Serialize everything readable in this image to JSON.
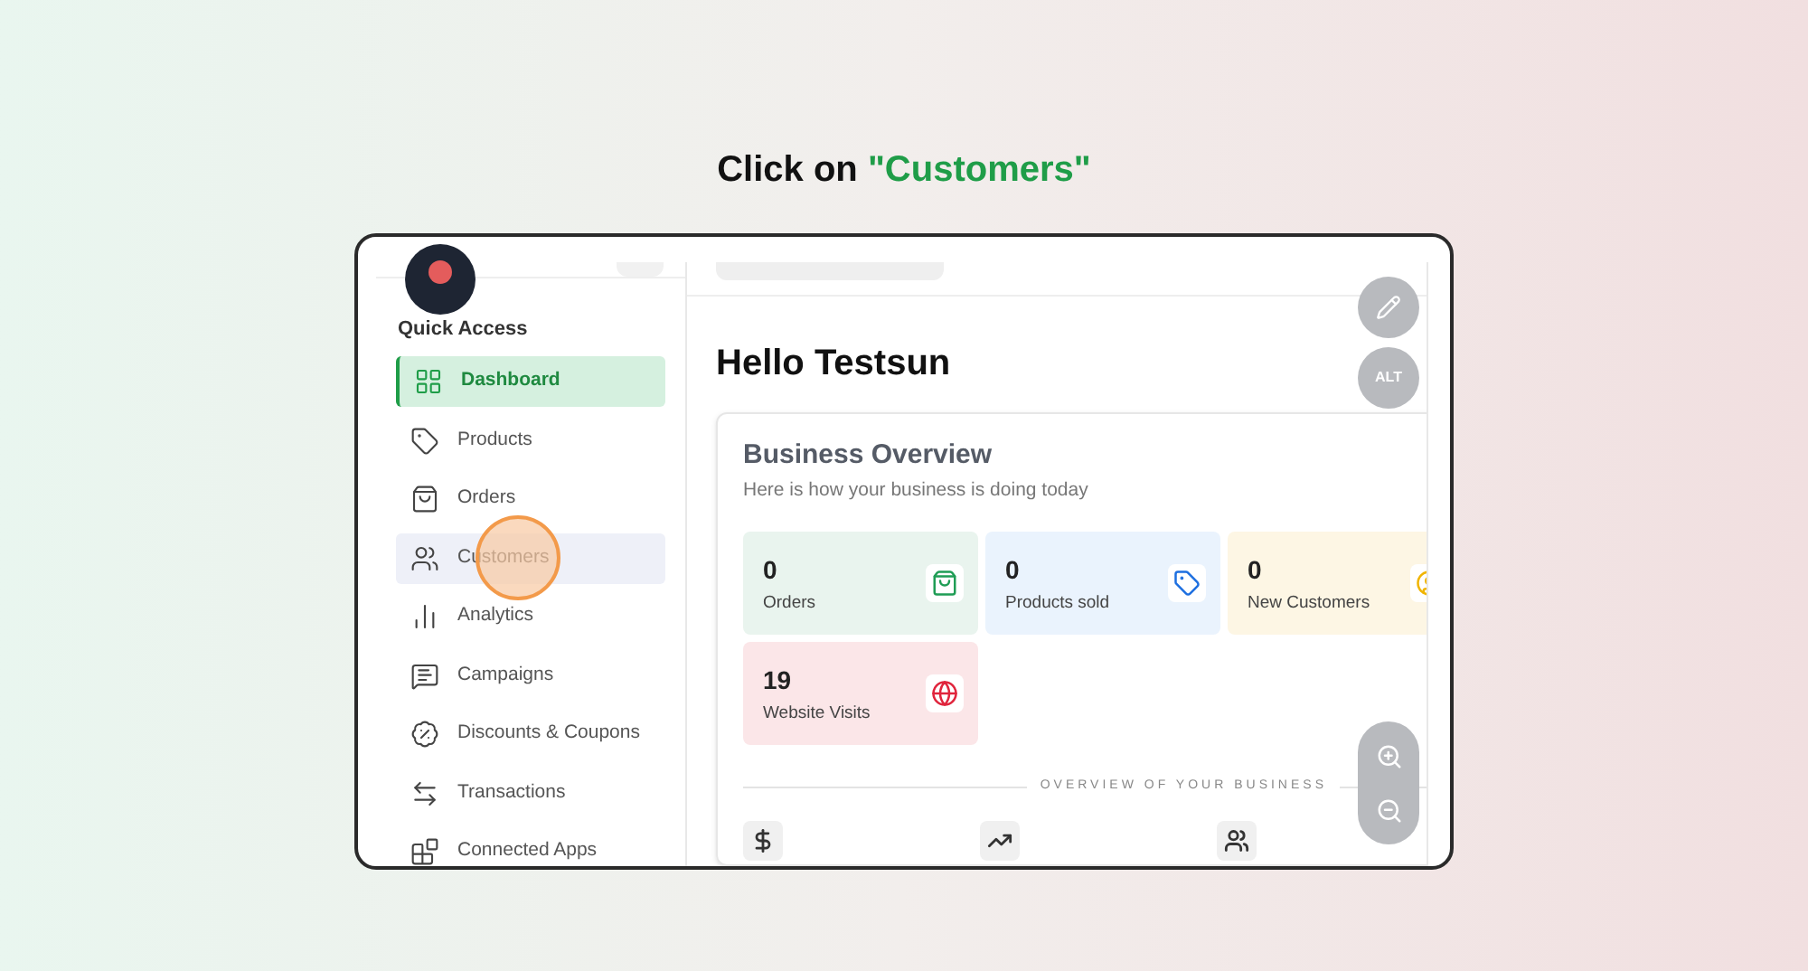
{
  "instruction": {
    "prefix": "Click on ",
    "target": "\"Customers\""
  },
  "sidebar": {
    "section_title": "Quick Access",
    "items": [
      {
        "label": "Dashboard",
        "selected": true,
        "hovered": false
      },
      {
        "label": "Products",
        "selected": false,
        "hovered": false
      },
      {
        "label": "Orders",
        "selected": false,
        "hovered": false
      },
      {
        "label": "Customers",
        "selected": false,
        "hovered": true
      },
      {
        "label": "Analytics",
        "selected": false,
        "hovered": false
      },
      {
        "label": "Campaigns",
        "selected": false,
        "hovered": false
      },
      {
        "label": "Discounts & Coupons",
        "selected": false,
        "hovered": false
      },
      {
        "label": "Transactions",
        "selected": false,
        "hovered": false
      },
      {
        "label": "Connected Apps",
        "selected": false,
        "hovered": false
      }
    ]
  },
  "greeting": "Hello Testsun",
  "overview": {
    "title": "Business Overview",
    "subtitle": "Here is how your business is doing today",
    "stats": [
      {
        "value": "0",
        "label": "Orders",
        "color": "#e9f4ee"
      },
      {
        "value": "0",
        "label": "Products sold",
        "color": "#eaf3fd"
      },
      {
        "value": "0",
        "label": "New Customers",
        "color": "#fdf6e4"
      },
      {
        "value": "19",
        "label": "Website Visits",
        "color": "#fbe6e8"
      }
    ],
    "divider_label": "OVERVIEW OF YOUR BUSINESS"
  },
  "floating": {
    "alt_label": "ALT"
  }
}
